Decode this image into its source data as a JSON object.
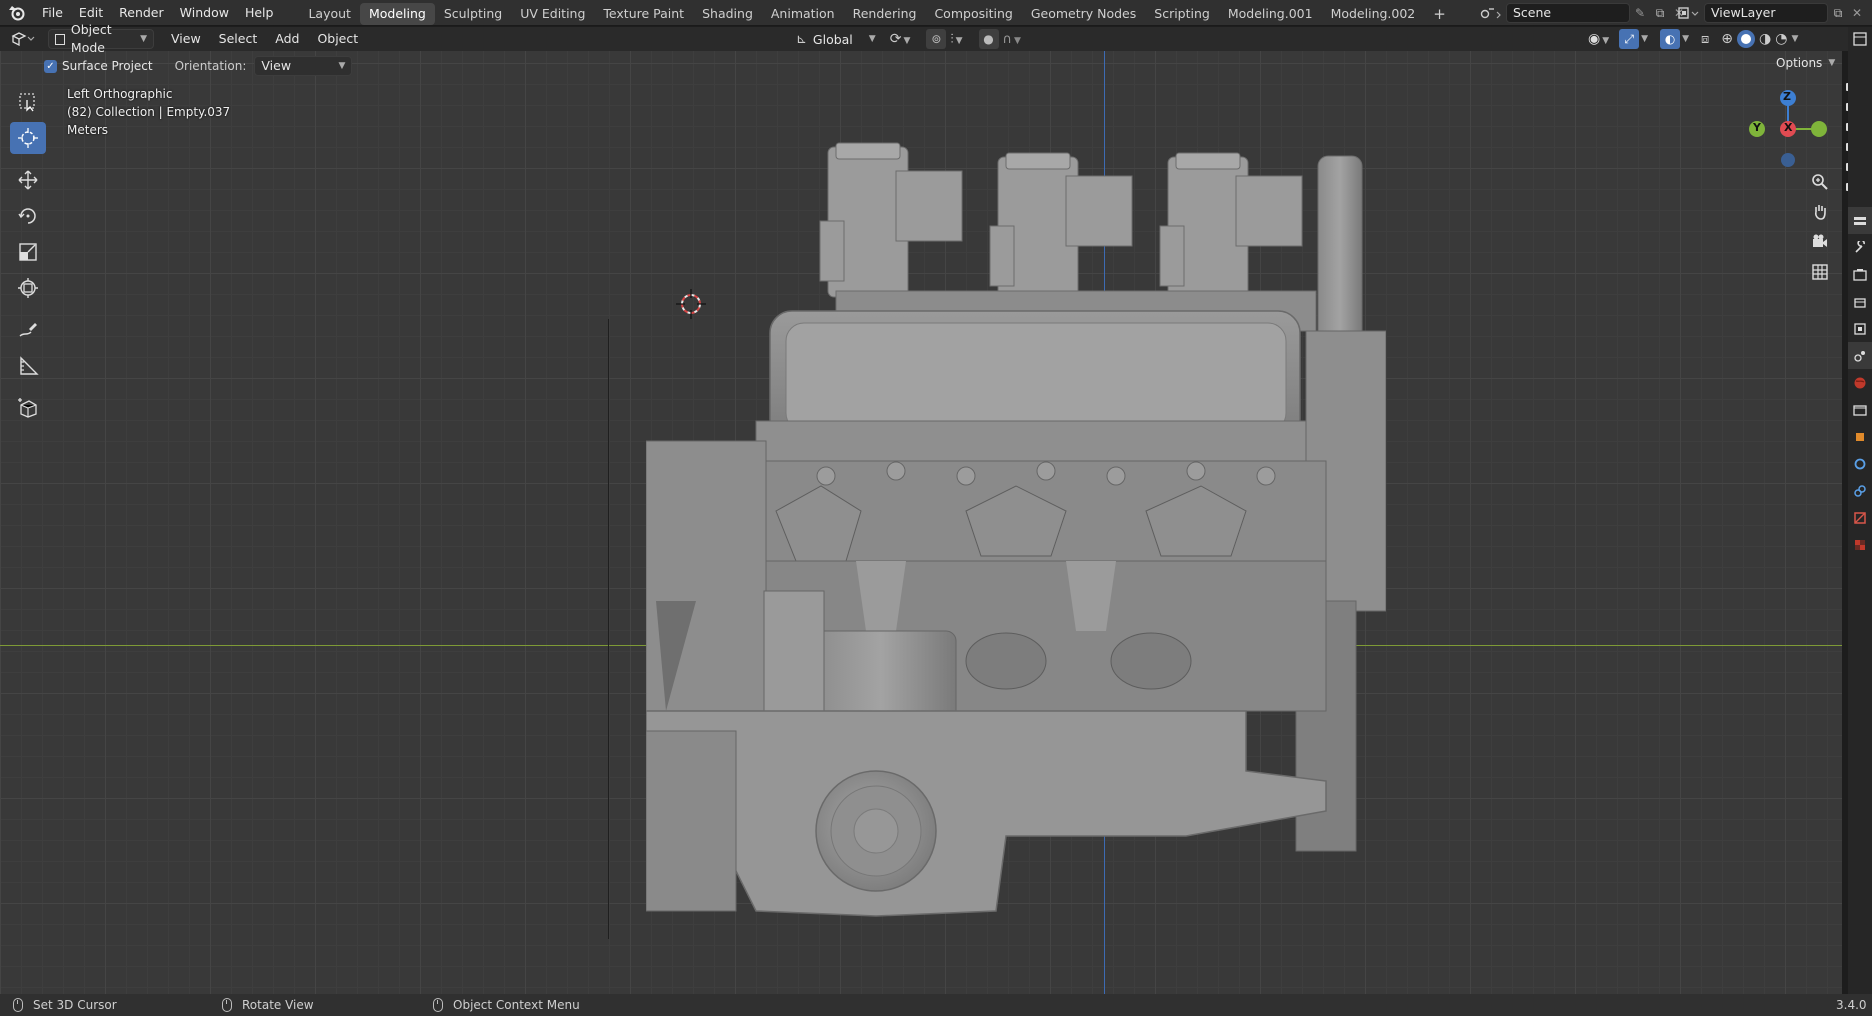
{
  "menu": {
    "items": [
      "File",
      "Edit",
      "Render",
      "Window",
      "Help"
    ]
  },
  "workspaces": {
    "tabs": [
      "Layout",
      "Modeling",
      "Sculpting",
      "UV Editing",
      "Texture Paint",
      "Shading",
      "Animation",
      "Rendering",
      "Compositing",
      "Geometry Nodes",
      "Scripting",
      "Modeling.001",
      "Modeling.002"
    ],
    "active": "Modeling",
    "add_label": "+"
  },
  "scene": {
    "name": "Scene"
  },
  "view_layer": {
    "name": "ViewLayer"
  },
  "header": {
    "mode": "Object Mode",
    "menus": [
      "View",
      "Select",
      "Add",
      "Object"
    ],
    "transform_orientation": "Global"
  },
  "tool_settings": {
    "surface_project_label": "Surface Project",
    "surface_project_checked": true,
    "orientation_label": "Orientation:",
    "orientation_value": "View",
    "options_label": "Options"
  },
  "viewport": {
    "view_name": "Left Orthographic",
    "collection_info": "(82) Collection | Empty.037",
    "units": "Meters"
  },
  "gizmo": {
    "z": "Z",
    "y": "Y",
    "x": "X"
  },
  "status": {
    "left_click": "Set 3D Cursor",
    "middle_click": "Rotate View",
    "right_click": "Object Context Menu",
    "version": "3.4.0"
  },
  "colors": {
    "accent": "#4772b3",
    "x_axis": "#e04b52",
    "y_axis": "#7fb43a",
    "z_axis": "#3d7fd3"
  }
}
